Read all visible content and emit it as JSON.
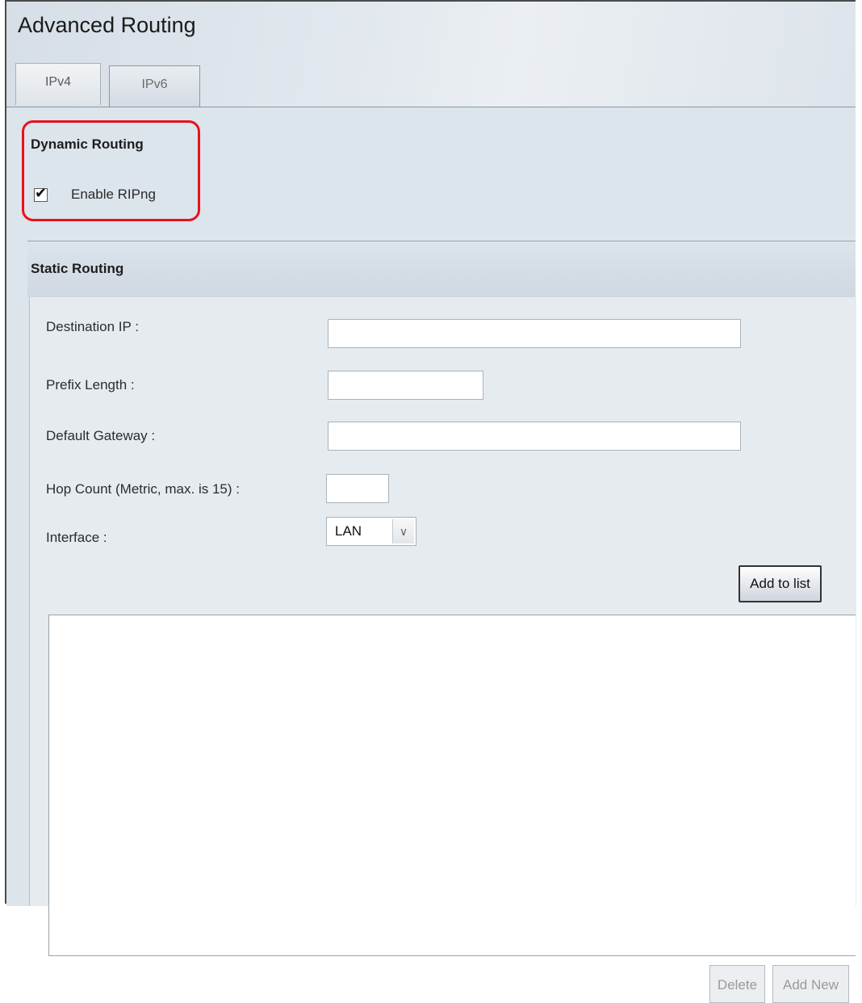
{
  "page": {
    "title": "Advanced Routing"
  },
  "tabs": [
    {
      "label": "IPv4",
      "active": false
    },
    {
      "label": "IPv6",
      "active": true
    }
  ],
  "dynamic_routing": {
    "title": "Dynamic Routing",
    "enable_ripng_label": "Enable RIPng",
    "enable_ripng_checked": true
  },
  "static_routing": {
    "title": "Static Routing",
    "fields": {
      "destination_ip": {
        "label": "Destination IP :",
        "value": ""
      },
      "prefix_length": {
        "label": "Prefix Length :",
        "value": ""
      },
      "default_gateway": {
        "label": "Default Gateway :",
        "value": ""
      },
      "hop_count": {
        "label": "Hop Count (Metric, max. is 15) :",
        "value": ""
      },
      "interface": {
        "label": "Interface :",
        "selected": "LAN"
      }
    },
    "add_to_list_label": "Add to list",
    "delete_label": "Delete",
    "add_new_label": "Add New"
  },
  "colors": {
    "highlight": "#e8121b",
    "panel_bg": "#dce4ec"
  },
  "icons": {
    "checkbox_check": "check-icon",
    "select_arrow": "chevron-down-icon"
  }
}
